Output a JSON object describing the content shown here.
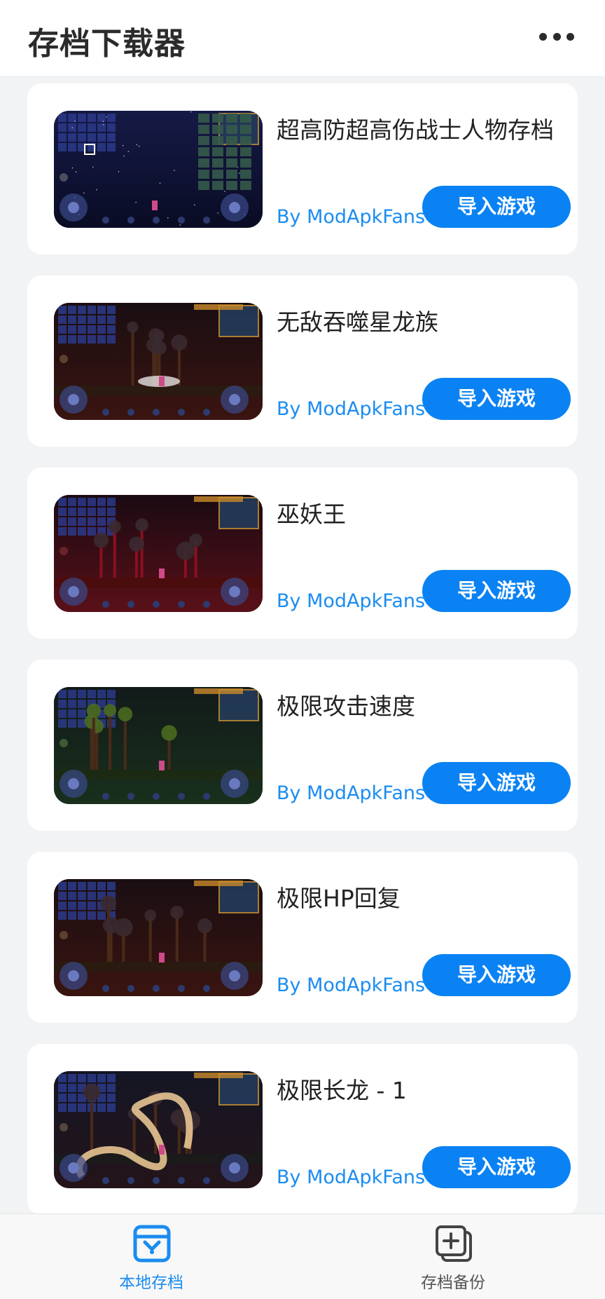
{
  "header": {
    "title": "存档下载器",
    "more_icon": "more-horizontal-icon"
  },
  "saves": [
    {
      "name": "超高防超高伤战士人物存档",
      "author": "By ModApkFans",
      "action": "导入游戏",
      "scene": "space"
    },
    {
      "name": "无敌吞噬星龙族",
      "author": "By ModApkFans",
      "action": "导入游戏",
      "scene": "forest"
    },
    {
      "name": "巫妖王",
      "author": "By ModApkFans",
      "action": "导入游戏",
      "scene": "crimson"
    },
    {
      "name": "极限攻击速度",
      "author": "By ModApkFans",
      "action": "导入游戏",
      "scene": "jungle"
    },
    {
      "name": "极限HP回复",
      "author": "By ModApkFans",
      "action": "导入游戏",
      "scene": "forest"
    },
    {
      "name": "极限长龙 - 1",
      "author": "By ModApkFans",
      "action": "导入游戏",
      "scene": "dragon"
    }
  ],
  "tabbar": {
    "local": {
      "label": "本地存档",
      "icon": "local-saves-icon",
      "active": true
    },
    "backup": {
      "label": "存档备份",
      "icon": "backup-copy-icon",
      "active": false
    }
  },
  "colors": {
    "accent": "#0a82f3",
    "author": "#1a8cf0",
    "background": "#f2f3f5"
  }
}
